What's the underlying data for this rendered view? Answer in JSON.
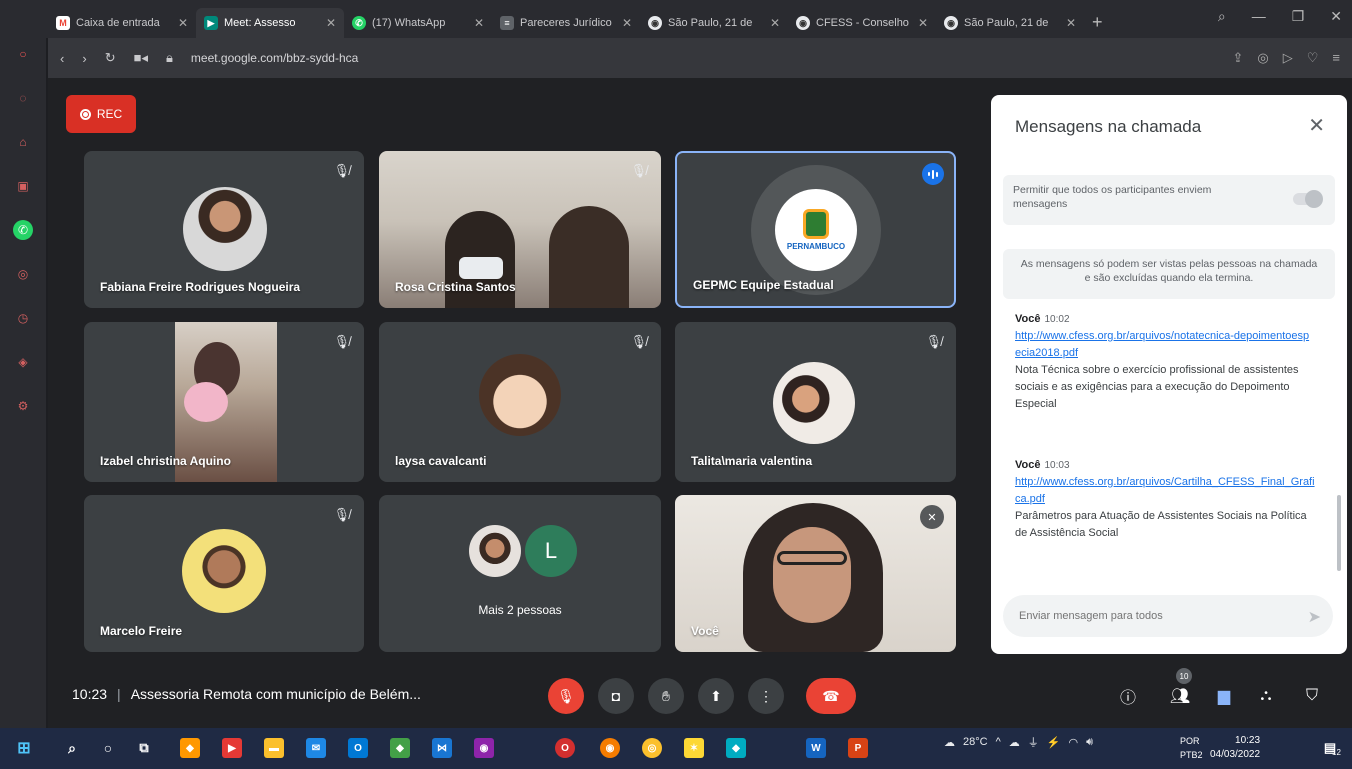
{
  "browser": {
    "tabs": [
      {
        "title": "Caixa de entrada",
        "favicon": "gmail-icon",
        "color": "#ea4335"
      },
      {
        "title": "Meet: Assesso",
        "favicon": "meet-icon",
        "color": "#00897b",
        "active": true
      },
      {
        "title": "(17) WhatsApp",
        "favicon": "whatsapp-icon",
        "color": "#25d366"
      },
      {
        "title": "Pareceres Jurídico",
        "favicon": "doc-icon",
        "color": "#9aa0a6"
      },
      {
        "title": "São Paulo, 21 de",
        "favicon": "globe-icon",
        "color": "#e8eaed"
      },
      {
        "title": "CFESS - Conselho",
        "favicon": "globe-icon",
        "color": "#e8eaed"
      },
      {
        "title": "São Paulo, 21 de",
        "favicon": "globe-icon",
        "color": "#e8eaed"
      }
    ],
    "url": "meet.google.com/bbz-sydd-hca"
  },
  "meet": {
    "rec_label": "REC",
    "participants": [
      {
        "name": "Fabiana Freire Rodrigues Nogueira",
        "muted": true
      },
      {
        "name": "Rosa Cristina Santos",
        "muted": true
      },
      {
        "name": "GEPMC Equipe Estadual",
        "speaking": true,
        "logo_text": "PERNAMBUCO"
      },
      {
        "name": "Izabel christina Aquino",
        "muted": true
      },
      {
        "name": "laysa cavalcanti",
        "muted": true
      },
      {
        "name": "Talita\\maria valentina",
        "muted": true
      },
      {
        "name": "Marcelo Freire",
        "muted": true
      },
      {
        "name": "Mais 2 pessoas",
        "avatar_letter": "L"
      },
      {
        "name": "Você",
        "muted": true
      }
    ],
    "time": "10:23",
    "meeting_title": "Assessoria Remota com município de Belém...",
    "people_count": "10"
  },
  "chat": {
    "title": "Mensagens na chamada",
    "allow_all_label": "Permitir que todos os participantes enviem mensagens",
    "info": "As mensagens só podem ser vistas pelas pessoas na chamada e são excluídas quando ela termina.",
    "messages": [
      {
        "author": "Você",
        "time": "10:02",
        "link": "http://www.cfess.org.br/arquivos/notatecnica-depoimentoespecia2018.pdf",
        "text": "Nota Técnica sobre o exercício profissional de assistentes sociais e as exigências para a execução do Depoimento Especial"
      },
      {
        "author": "Você",
        "time": "10:03",
        "link": "http://www.cfess.org.br/arquivos/Cartilha_CFESS_Final_Grafica.pdf",
        "text": "Parâmetros para Atuação de Assistentes Sociais na Política de Assistência Social"
      }
    ],
    "input_placeholder": "Enviar mensagem para todos"
  },
  "taskbar": {
    "weather": "28°C",
    "lang_top": "POR",
    "lang_bottom": "PTB2",
    "clock_time": "10:23",
    "clock_date": "04/03/2022",
    "notif_count": "12"
  },
  "colors": {
    "meet_bg": "#202124",
    "tile_bg": "#3c4043",
    "accent_red": "#ea4335",
    "speaking_border": "#8ab4f8",
    "link_blue": "#1a73e8"
  }
}
